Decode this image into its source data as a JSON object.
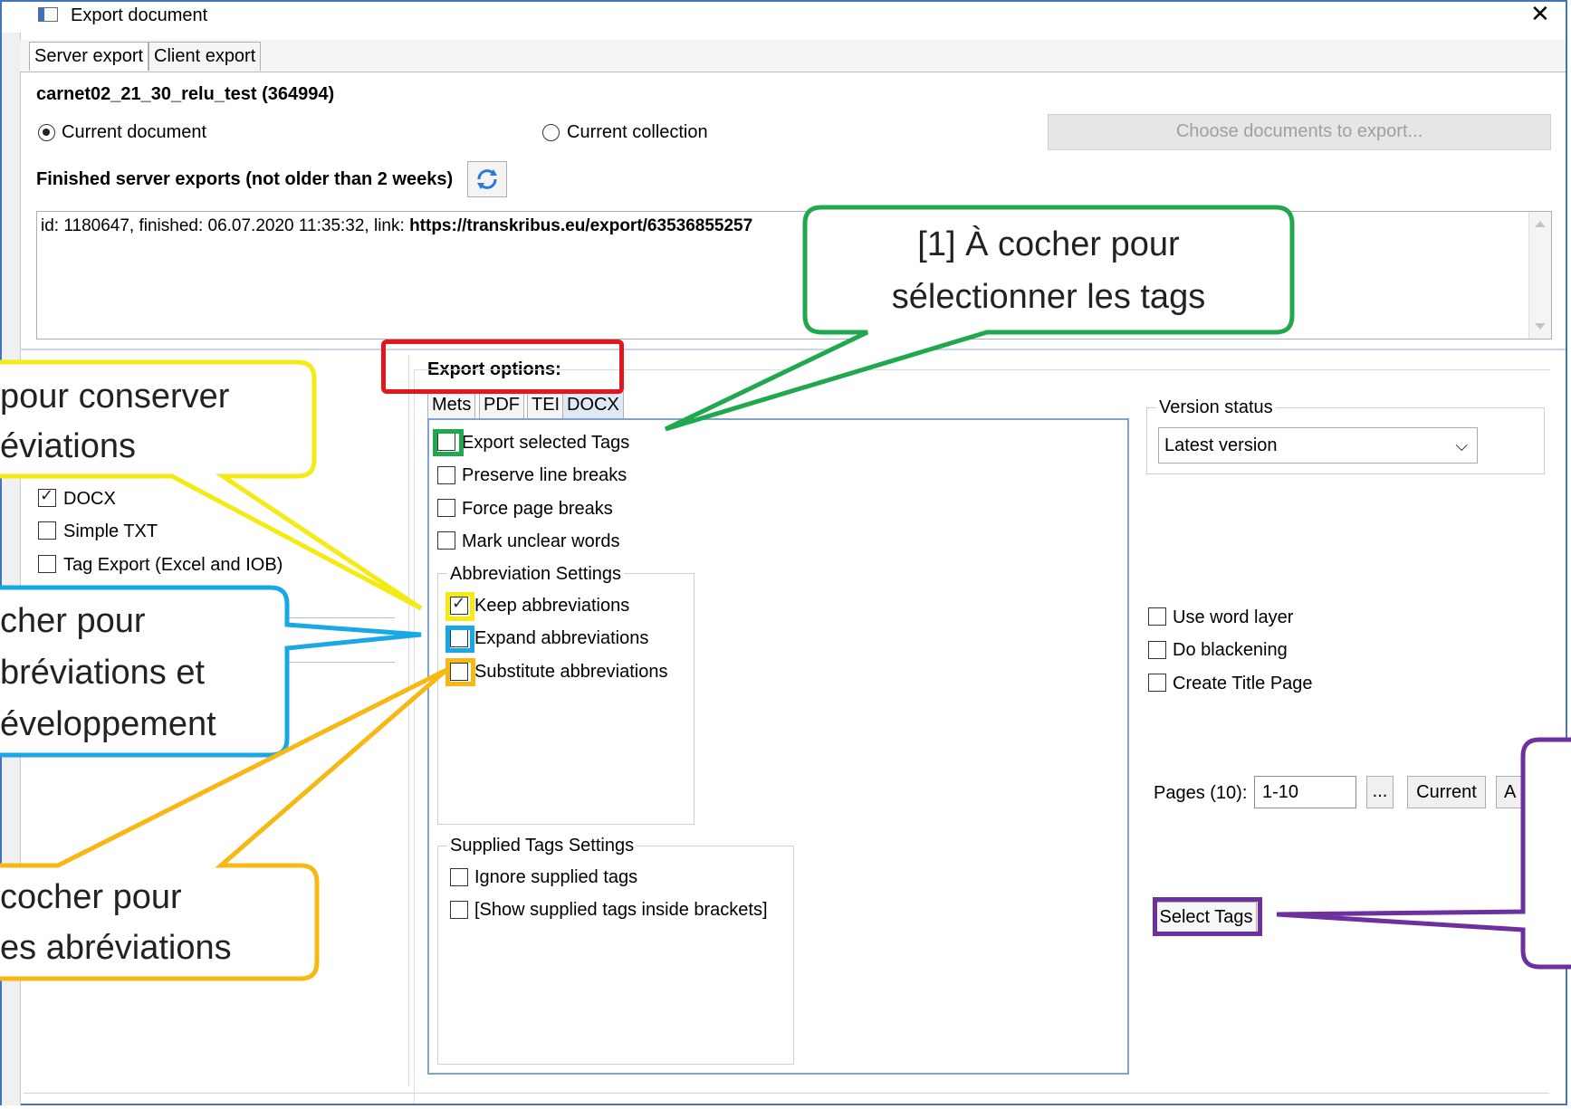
{
  "window": {
    "title": "Export document",
    "close_glyph": "✕"
  },
  "tabs": [
    {
      "label": "Server export",
      "active": true
    },
    {
      "label": "Client export",
      "active": false
    }
  ],
  "document": {
    "name": "carnet02_21_30_relu_test (364994)",
    "scope_current_document": "Current document",
    "scope_current_collection": "Current collection",
    "choose_button": "Choose documents to export...",
    "finished_label": "Finished server exports (not older than 2 weeks)",
    "export_line_prefix": "id: 1180647, finished: 06.07.2020 11:35:32, link: ",
    "export_link": "https://transkribus.eu/export/63536855257"
  },
  "left_formats": [
    {
      "label": "DOCX",
      "checked": true
    },
    {
      "label": "Simple TXT",
      "checked": false
    },
    {
      "label": "Tag Export (Excel and IOB)",
      "checked": false
    }
  ],
  "export_options": {
    "title": "Export options:",
    "subtabs": [
      "Mets",
      "PDF",
      "TEI",
      "DOCX"
    ],
    "active_subtab": "DOCX",
    "options": [
      {
        "label": "Export selected Tags",
        "checked": false
      },
      {
        "label": "Preserve line breaks",
        "checked": false
      },
      {
        "label": "Force page breaks",
        "checked": false
      },
      {
        "label": "Mark unclear words",
        "checked": false
      }
    ],
    "abbreviation_group": "Abbreviation Settings",
    "abbreviations": [
      {
        "label": "Keep abbreviations",
        "checked": true
      },
      {
        "label": "Expand abbreviations",
        "checked": false
      },
      {
        "label": "Substitute abbreviations",
        "checked": false
      }
    ],
    "supplied_group": "Supplied Tags Settings",
    "supplied": [
      {
        "label": "Ignore supplied tags",
        "checked": false
      },
      {
        "label": "[Show supplied tags inside brackets]",
        "checked": false
      }
    ]
  },
  "right_panel": {
    "version_status_label": "Version status",
    "version_value": "Latest version",
    "options": [
      {
        "label": "Use word layer",
        "checked": false
      },
      {
        "label": "Do blackening",
        "checked": false
      },
      {
        "label": "Create Title Page",
        "checked": false
      }
    ],
    "pages_label": "Pages (10):",
    "pages_value": "1-10",
    "ellipsis_button": "...",
    "current_button": "Current",
    "all_button_partial": "A",
    "select_tags_button": "Select Tags"
  },
  "annotations": {
    "green_line1": "[1] À cocher pour",
    "green_line2": "sélectionner les tags",
    "yellow_line1": "pour conserver",
    "yellow_line2": "éviations",
    "blue_line1": "cher pour",
    "blue_line2": "bréviations et",
    "blue_line3": "éveloppement",
    "orange_line1": "cocher pour",
    "orange_line2": "es abréviations",
    "colors": {
      "green": "#1fa84e",
      "yellow": "#f5ea14",
      "blue": "#18a8e6",
      "orange": "#f7b814",
      "purple": "#6e2f9f",
      "red": "#e3171b",
      "frame": "#4472c4"
    }
  }
}
